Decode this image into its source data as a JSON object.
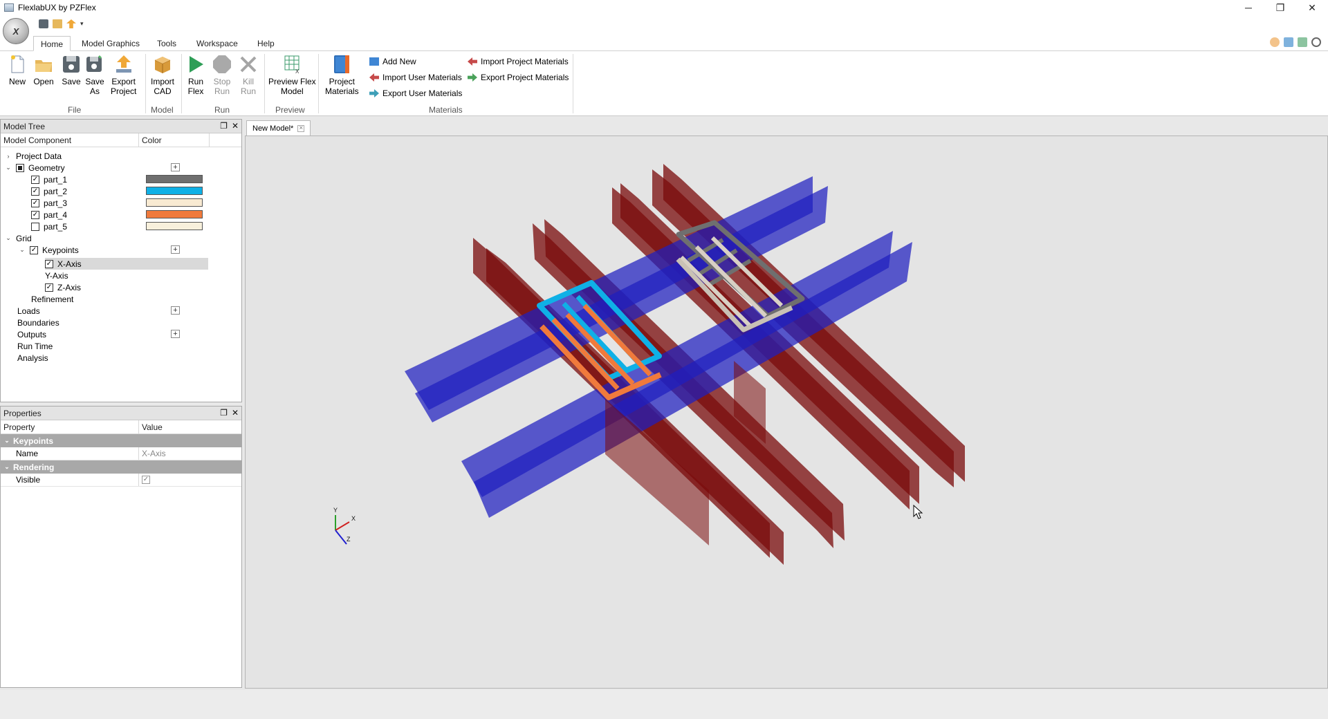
{
  "window": {
    "title": "FlexlabUX by PZFlex",
    "minimize": "─",
    "restore": "❐",
    "close": "✕"
  },
  "orb_label": "X",
  "ribbon_tabs": [
    "Home",
    "Model Graphics",
    "Tools",
    "Workspace",
    "Help"
  ],
  "ribbon": {
    "file": {
      "new": "New",
      "open": "Open",
      "save": "Save",
      "save_as_1": "Save",
      "save_as_2": "As",
      "export_1": "Export",
      "export_2": "Project",
      "label": "File"
    },
    "model": {
      "import_1": "Import",
      "import_2": "CAD",
      "label": "Model"
    },
    "run": {
      "run_1": "Run",
      "run_2": "Flex",
      "stop_1": "Stop",
      "stop_2": "Run",
      "kill_1": "Kill",
      "kill_2": "Run",
      "label": "Run"
    },
    "preview": {
      "btn_1": "Preview Flex",
      "btn_2": "Model",
      "label": "Preview"
    },
    "materials": {
      "project_1": "Project",
      "project_2": "Materials",
      "add_new": "Add New",
      "import_user": "Import User Materials",
      "export_user": "Export User Materials",
      "import_project": "Import Project Materials",
      "export_project": "Export Project Materials",
      "label": "Materials"
    }
  },
  "model_tree": {
    "title": "Model Tree",
    "col_component": "Model Component",
    "col_color": "Color",
    "project_data": "Project Data",
    "geometry": "Geometry",
    "parts": [
      {
        "name": "part_1",
        "color": "#6f6f6f",
        "checked": true
      },
      {
        "name": "part_2",
        "color": "#0fb0e6",
        "checked": true
      },
      {
        "name": "part_3",
        "color": "#f8ead2",
        "checked": true
      },
      {
        "name": "part_4",
        "color": "#f07a3c",
        "checked": true
      },
      {
        "name": "part_5",
        "color": "#f8f0dc",
        "checked": false
      }
    ],
    "grid": "Grid",
    "keypoints": "Keypoints",
    "x_axis": "X-Axis",
    "y_axis": "Y-Axis",
    "z_axis": "Z-Axis",
    "refinement": "Refinement",
    "loads": "Loads",
    "boundaries": "Boundaries",
    "outputs": "Outputs",
    "run_time": "Run Time",
    "analysis": "Analysis",
    "plus": "+"
  },
  "properties": {
    "title": "Properties",
    "col_property": "Property",
    "col_value": "Value",
    "section_keypoints": "Keypoints",
    "name_key": "Name",
    "name_value": "X-Axis",
    "section_rendering": "Rendering",
    "visible_key": "Visible"
  },
  "document_tab": "New Model*",
  "axes": {
    "x": "X",
    "y": "Y",
    "z": "Z"
  },
  "colors": {
    "blue_plane": "#1f1fbf",
    "red_plane": "#7a0b0b",
    "part_gray": "#6f6f6f",
    "part_blue": "#0fb0e6",
    "part_orange": "#f07a3c"
  }
}
